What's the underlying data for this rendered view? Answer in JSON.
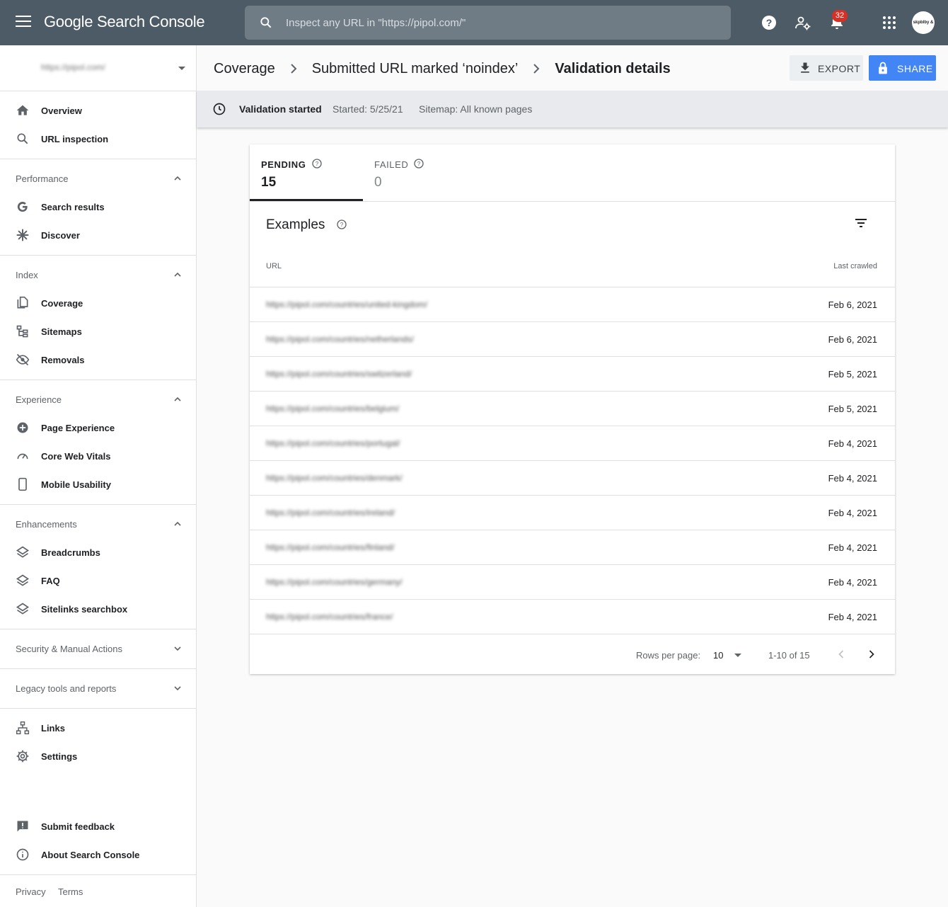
{
  "app": {
    "title": "Google Search Console",
    "search_placeholder": "Inspect any URL in \"https://pipol.com/\"",
    "notification_count": "32",
    "avatar_text": "skpblby & co"
  },
  "sidebar": {
    "property": "https://pipol.com/",
    "items_top": [
      {
        "label": "Overview",
        "icon": "home-icon"
      },
      {
        "label": "URL inspection",
        "icon": "search-icon"
      }
    ],
    "sections": [
      {
        "label": "Performance",
        "expanded": true,
        "items": [
          {
            "label": "Search results",
            "icon": "google-g-icon"
          },
          {
            "label": "Discover",
            "icon": "asterisk-icon"
          }
        ]
      },
      {
        "label": "Index",
        "expanded": true,
        "items": [
          {
            "label": "Coverage",
            "icon": "file-copy-icon"
          },
          {
            "label": "Sitemaps",
            "icon": "sitemap-icon"
          },
          {
            "label": "Removals",
            "icon": "eye-off-icon"
          }
        ]
      },
      {
        "label": "Experience",
        "expanded": true,
        "items": [
          {
            "label": "Page Experience",
            "icon": "plus-circle-icon"
          },
          {
            "label": "Core Web Vitals",
            "icon": "speedometer-icon"
          },
          {
            "label": "Mobile Usability",
            "icon": "phone-icon"
          }
        ]
      },
      {
        "label": "Enhancements",
        "expanded": true,
        "items": [
          {
            "label": "Breadcrumbs",
            "icon": "layers-icon"
          },
          {
            "label": "FAQ",
            "icon": "layers-icon"
          },
          {
            "label": "Sitelinks searchbox",
            "icon": "layers-icon"
          }
        ]
      },
      {
        "label": "Security & Manual Actions",
        "expanded": false
      },
      {
        "label": "Legacy tools and reports",
        "expanded": false
      }
    ],
    "items_bottom": [
      {
        "label": "Links",
        "icon": "links-icon"
      },
      {
        "label": "Settings",
        "icon": "gear-icon"
      }
    ],
    "feedback": [
      {
        "label": "Submit feedback",
        "icon": "feedback-icon"
      },
      {
        "label": "About Search Console",
        "icon": "info-icon"
      }
    ],
    "footer": {
      "privacy": "Privacy",
      "terms": "Terms"
    }
  },
  "breadcrumbs": [
    "Coverage",
    "Submitted URL marked ‘noindex’",
    "Validation details"
  ],
  "actions": {
    "export": "EXPORT",
    "share": "SHARE"
  },
  "banner": {
    "status": "Validation started",
    "started": "Started: 5/25/21",
    "sitemap": "Sitemap: All known pages"
  },
  "tabs": [
    {
      "label": "PENDING",
      "count": "15",
      "active": true
    },
    {
      "label": "FAILED",
      "count": "0",
      "active": false
    }
  ],
  "examples": {
    "title": "Examples",
    "columns": {
      "url": "URL",
      "last_crawled": "Last crawled"
    },
    "rows": [
      {
        "url": "https://pipol.com/countries/united-kingdom/",
        "date": "Feb 6, 2021"
      },
      {
        "url": "https://pipol.com/countries/netherlands/",
        "date": "Feb 6, 2021"
      },
      {
        "url": "https://pipol.com/countries/switzerland/",
        "date": "Feb 5, 2021"
      },
      {
        "url": "https://pipol.com/countries/belgium/",
        "date": "Feb 5, 2021"
      },
      {
        "url": "https://pipol.com/countries/portugal/",
        "date": "Feb 4, 2021"
      },
      {
        "url": "https://pipol.com/countries/denmark/",
        "date": "Feb 4, 2021"
      },
      {
        "url": "https://pipol.com/countries/ireland/",
        "date": "Feb 4, 2021"
      },
      {
        "url": "https://pipol.com/countries/finland/",
        "date": "Feb 4, 2021"
      },
      {
        "url": "https://pipol.com/countries/germany/",
        "date": "Feb 4, 2021"
      },
      {
        "url": "https://pipol.com/countries/france/",
        "date": "Feb 4, 2021"
      }
    ],
    "pagination": {
      "rows_per_page_label": "Rows per page:",
      "rows_per_page": "10",
      "range": "1-10 of 15"
    }
  },
  "colors": {
    "topbar": "#4d5b66",
    "accent": "#4285f4",
    "badge": "#d93025"
  }
}
